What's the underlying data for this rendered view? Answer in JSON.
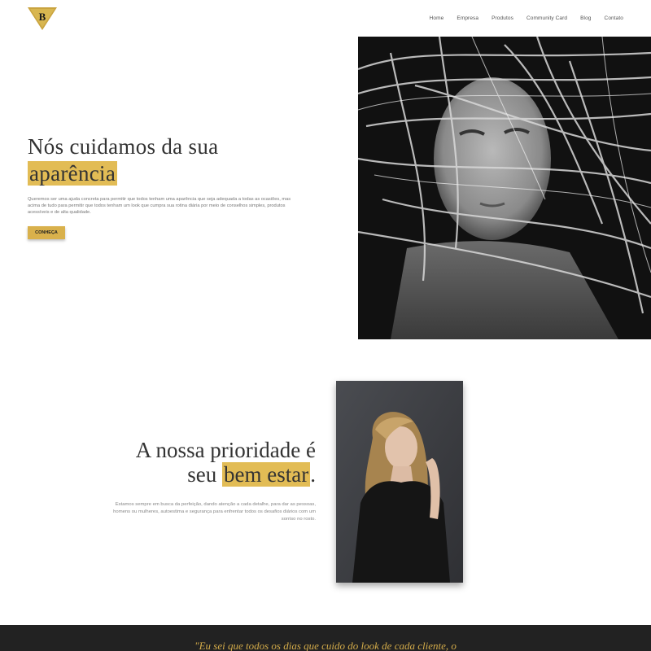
{
  "header": {
    "logo_alt": "B",
    "nav": [
      "Home",
      "Empresa",
      "Produtos",
      "Community Card",
      "Blog",
      "Contato"
    ]
  },
  "hero": {
    "title_line1": "Nós cuidamos da sua",
    "title_highlight": "aparência",
    "text": "Queremos ser uma ajuda concreta para permitir que todos tenham uma aparência que seja adequada a todas as ocasiões, mas acima de tudo para permitir que todos tenham um look que cumpra sua rotina diária por meio de conselhos simples, produtos acessíveis e de alta qualidade.",
    "button_label": "CONHEÇA"
  },
  "priority": {
    "title_line1": "A nossa prioridade é",
    "title_prefix": "seu",
    "title_highlight": "bem estar",
    "title_suffix": ".",
    "text": "Estamos sempre em busca da perfeição, dando atenção a cada detalhe, para dar as pessoas, homens ou mulheres, autoestima e segurança para enfrentar todos os desafios diários com um sorriso no rosto."
  },
  "quote": {
    "text": "\"Eu sei que todos os dias que cuido do look de cada cliente, o"
  },
  "colors": {
    "accent": "#e2bc55",
    "button": "#d9b14c",
    "footer_bg": "#222222",
    "quote_text": "#d4ac4a"
  }
}
